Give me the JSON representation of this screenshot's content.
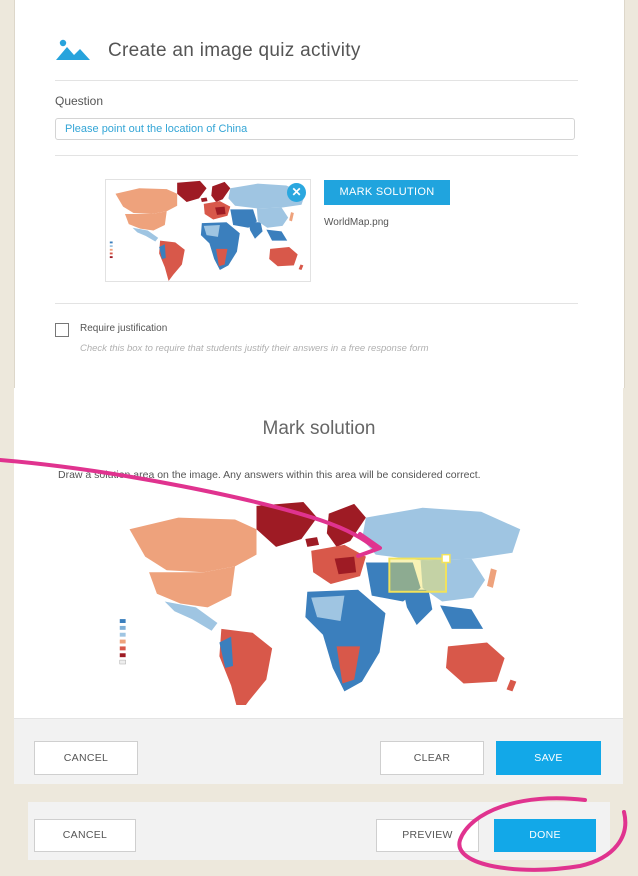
{
  "activity_form": {
    "title": "Create an image quiz activity",
    "title_icon": "landscape-image-icon",
    "question_label": "Question",
    "question_value": "Please point out the location of China",
    "image_filename": "WorldMap.png",
    "mark_solution_button": "MARK SOLUTION",
    "remove_image_icon": "close-icon",
    "require_justification": {
      "label": "Require justification",
      "hint": "Check this box to require that students justify their answers in a free response form",
      "checked": false
    }
  },
  "mark_solution": {
    "title": "Mark solution",
    "description": "Draw a solution area on the image. Any answers within this area will be considered correct."
  },
  "inner_actions": {
    "cancel": "CANCEL",
    "clear": "CLEAR",
    "save": "SAVE"
  },
  "outer_actions": {
    "cancel": "CANCEL",
    "preview": "PREVIEW",
    "done": "DONE"
  },
  "colors": {
    "accent_blue": "#12a8e8",
    "annotation_magenta": "#e0338f",
    "selection_yellow": "#f2e35a",
    "map_dark_red": "#9e1b24",
    "map_red": "#d8584a",
    "map_salmon": "#eea27c",
    "map_light_blue": "#9fc5e2",
    "map_blue": "#3b7fbd"
  }
}
